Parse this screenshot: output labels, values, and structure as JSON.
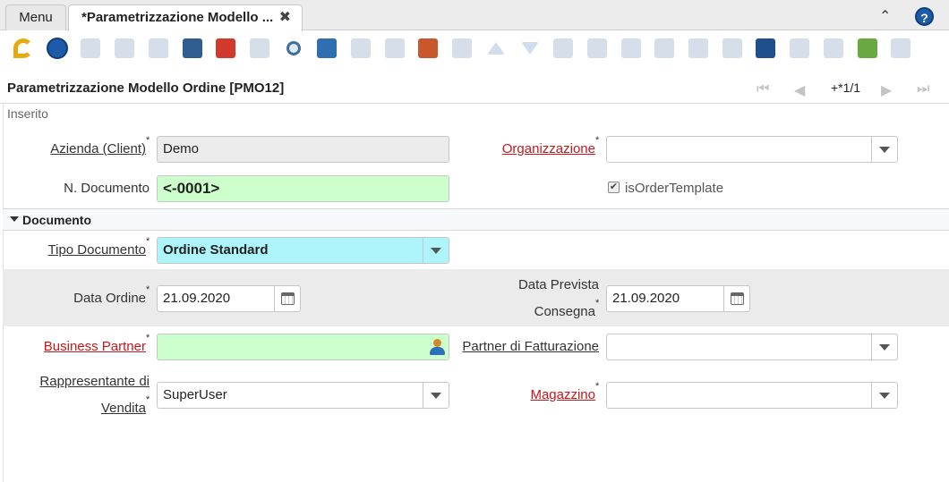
{
  "tabs": {
    "menu_label": "Menu",
    "active_label": "*Parametrizzazione Modello ...",
    "close_symbol": "✖",
    "collapse_symbol": "⌃",
    "help_symbol": "?"
  },
  "toolbar": {
    "buttons": [
      {
        "icon": "undo-icon",
        "enabled": true
      },
      {
        "icon": "help-icon",
        "enabled": true
      },
      {
        "icon": "new-record-icon",
        "enabled": false
      },
      {
        "icon": "copy-record-icon",
        "enabled": false
      },
      {
        "icon": "delete-icon",
        "enabled": false
      },
      {
        "icon": "save-icon",
        "enabled": true
      },
      {
        "icon": "save-and-create-icon",
        "enabled": true
      },
      {
        "icon": "refresh-icon",
        "enabled": false
      },
      {
        "icon": "find-icon",
        "enabled": true
      },
      {
        "icon": "attachment-icon",
        "enabled": true
      },
      {
        "icon": "chat-icon",
        "enabled": false
      },
      {
        "icon": "archive-icon",
        "enabled": false
      },
      {
        "icon": "grid-toggle-icon",
        "enabled": true
      },
      {
        "icon": "multi-row-icon",
        "enabled": false
      },
      {
        "icon": "previous-record-icon",
        "enabled": false
      },
      {
        "icon": "next-record-icon",
        "enabled": false
      },
      {
        "icon": "report-icon",
        "enabled": false
      },
      {
        "icon": "archived-docs-icon",
        "enabled": false
      },
      {
        "icon": "print-icon",
        "enabled": false
      },
      {
        "icon": "zoom-across-icon",
        "enabled": false
      },
      {
        "icon": "workflow-icon",
        "enabled": false
      },
      {
        "icon": "chart-icon",
        "enabled": false
      },
      {
        "icon": "customize-icon",
        "enabled": true
      },
      {
        "icon": "process-gear-icon",
        "enabled": false
      },
      {
        "icon": "export-icon",
        "enabled": false
      },
      {
        "icon": "import-icon",
        "enabled": true
      },
      {
        "icon": "post-it-icon",
        "enabled": false
      }
    ]
  },
  "header": {
    "title": "Parametrizzazione Modello Ordine [PMO12]",
    "record_indicator": "+*1/1"
  },
  "status": "Inserito",
  "form": {
    "client_label": "Azienda (Client)",
    "client_value": "Demo",
    "org_label": "Organizzazione",
    "org_value": "",
    "docno_label": "N. Documento",
    "docno_value": "<-0001>",
    "template_label": "isOrderTemplate",
    "template_checked": true,
    "section_label": "Documento",
    "doctype_label": "Tipo Documento",
    "doctype_value": "Ordine Standard",
    "orderdate_label": "Data Ordine",
    "orderdate_value": "21.09.2020",
    "promised_label_1": "Data Prevista",
    "promised_label_2": "Consegna",
    "promised_value": "21.09.2020",
    "bp_label": "Business Partner",
    "bp_value": "",
    "billpartner_label": "Partner di Fatturazione",
    "billpartner_value": "",
    "salesrep_label_1": "Rappresentante di",
    "salesrep_label_2": "Vendita",
    "salesrep_value": "SuperUser",
    "warehouse_label": "Magazzino",
    "warehouse_value": "",
    "required_mark": "*"
  },
  "colors": {
    "required_label": "#c8171b",
    "mandatory_bg": "#ccffcc",
    "doctype_bg": "#aef4fb"
  }
}
